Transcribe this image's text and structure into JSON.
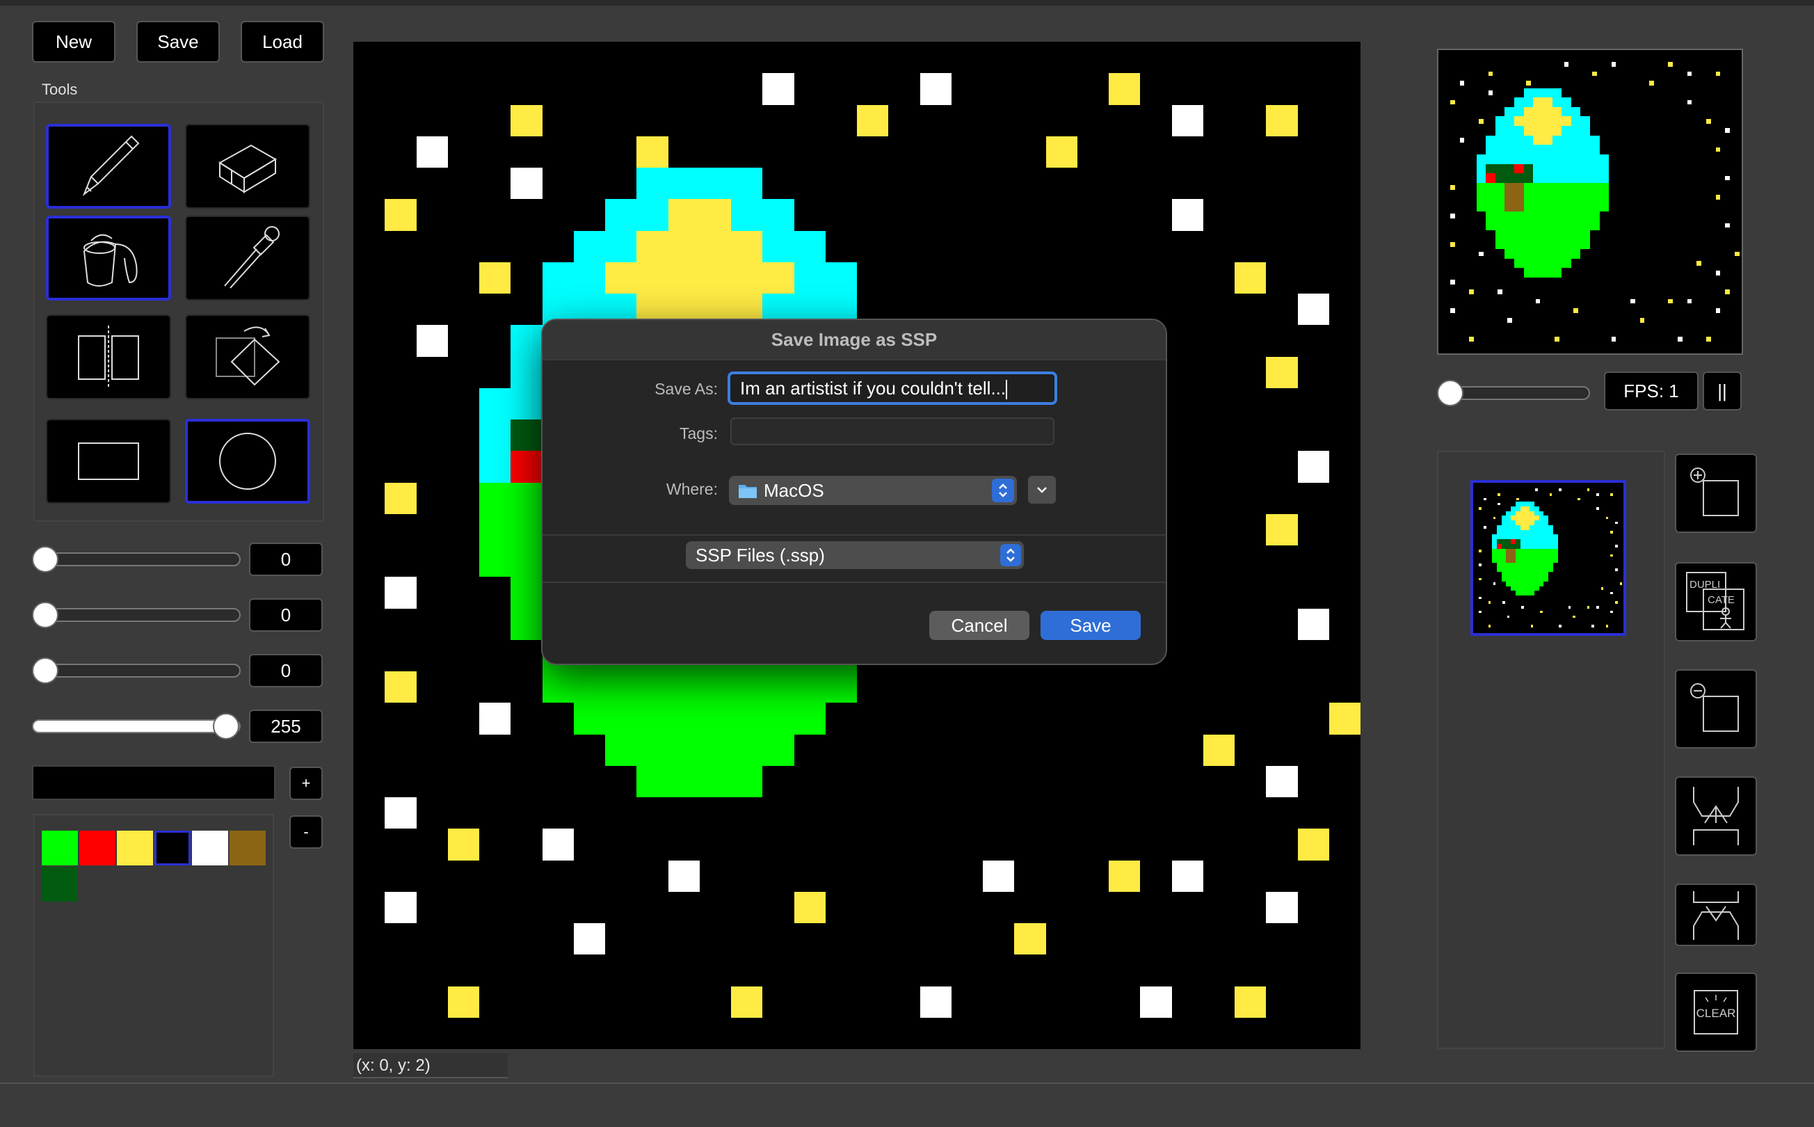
{
  "toolbar": {
    "new_label": "New",
    "save_label": "Save",
    "load_label": "Load"
  },
  "tools": {
    "heading": "Tools",
    "items": [
      {
        "icon": "pencil-icon",
        "selected": true
      },
      {
        "icon": "eraser-icon",
        "selected": false
      },
      {
        "icon": "paint-bucket-icon",
        "selected": true
      },
      {
        "icon": "eyedropper-icon",
        "selected": false
      },
      {
        "icon": "mirror-icon",
        "selected": false
      },
      {
        "icon": "rotate-icon",
        "selected": false
      },
      {
        "icon": "rectangle-icon",
        "selected": false
      },
      {
        "icon": "circle-icon",
        "selected": true
      }
    ]
  },
  "sliders": [
    {
      "value": "0"
    },
    {
      "value": "0"
    },
    {
      "value": "0"
    },
    {
      "value": "255"
    }
  ],
  "color": {
    "current": "#000000",
    "add_label": "+",
    "remove_label": "-"
  },
  "palette": [
    "#00ff00",
    "#ff0000",
    "#ffeb44",
    "#000000",
    "#ffffff",
    "#8b6514",
    "#005a10"
  ],
  "colors": {
    "sky": "#00ffff",
    "grass": "#00ff00",
    "sun": "#ffeb44",
    "white_star": "#ffffff",
    "accent": "#2a2fd6",
    "save_blue": "#2f6ed7"
  },
  "status": {
    "coordinates": "(x: 0, y: 2)"
  },
  "animation": {
    "fps_label": "FPS: 1",
    "pause_label": "||"
  },
  "frame_buttons": [
    {
      "icon": "add-frame-icon"
    },
    {
      "icon": "duplicate-frame-icon",
      "text": "DUPLI CATE"
    },
    {
      "icon": "remove-frame-icon"
    },
    {
      "icon": "move-frame-up-icon"
    },
    {
      "icon": "move-frame-down-icon"
    },
    {
      "icon": "clear-frame-icon",
      "text": "CLEAR"
    }
  ],
  "dialog": {
    "title": "Save Image as SSP",
    "save_as_label": "Save As:",
    "save_as_value": "Im an artistist if you couldn't tell...",
    "tags_label": "Tags:",
    "tags_value": "",
    "where_label": "Where:",
    "where_value": "MacOS",
    "format_value": "SSP Files (.ssp)",
    "cancel_label": "Cancel",
    "save_label": "Save"
  }
}
